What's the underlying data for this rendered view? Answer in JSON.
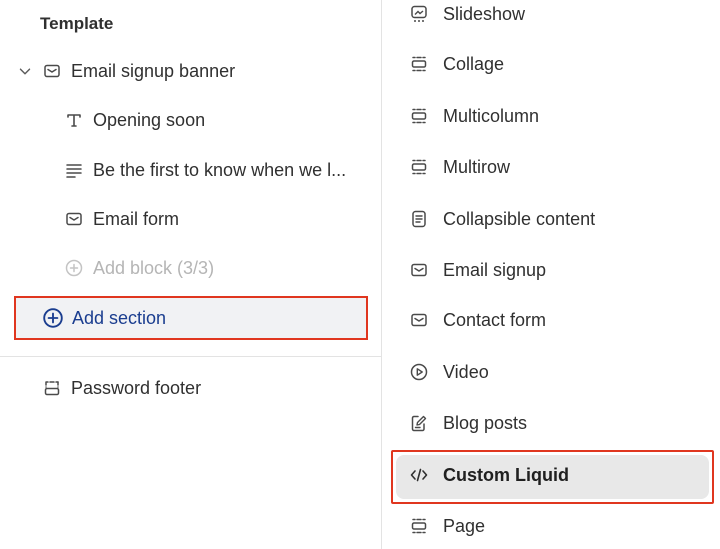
{
  "left_panel": {
    "heading": "Template",
    "section": {
      "label": "Email signup banner",
      "blocks": [
        {
          "label": "Opening soon",
          "icon": "text-icon"
        },
        {
          "label": "Be the first to know when we l...",
          "icon": "paragraph-icon"
        },
        {
          "label": "Email form",
          "icon": "email-icon"
        }
      ],
      "add_block": "Add block (3/3)"
    },
    "add_section": "Add section",
    "footer": "Password footer"
  },
  "section_menu": {
    "items": [
      {
        "label": "Slideshow",
        "icon": "slideshow-icon"
      },
      {
        "label": "Collage",
        "icon": "section-icon"
      },
      {
        "label": "Multicolumn",
        "icon": "section-icon"
      },
      {
        "label": "Multirow",
        "icon": "section-icon"
      },
      {
        "label": "Collapsible content",
        "icon": "collapsible-icon"
      },
      {
        "label": "Email signup",
        "icon": "email-icon"
      },
      {
        "label": "Contact form",
        "icon": "email-icon"
      },
      {
        "label": "Video",
        "icon": "play-icon"
      },
      {
        "label": "Blog posts",
        "icon": "edit-icon"
      },
      {
        "label": "Custom Liquid",
        "icon": "code-icon"
      },
      {
        "label": "Page",
        "icon": "section-icon"
      }
    ],
    "selected": "Custom Liquid"
  },
  "colors": {
    "highlight_border": "#e0361f",
    "link_blue": "#1a3d8f",
    "text": "#303030"
  }
}
